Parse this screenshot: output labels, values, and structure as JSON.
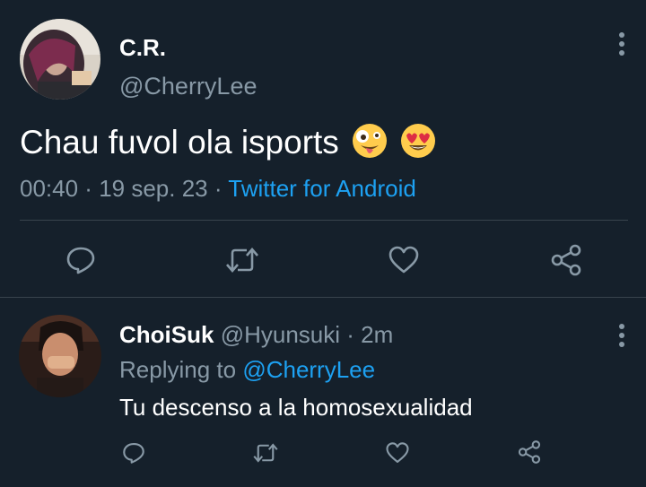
{
  "main_tweet": {
    "display_name": "C.R.",
    "handle": "@CherryLee",
    "text": "Chau fuvol ola isports",
    "emojis": [
      "zany-face-emoji",
      "heart-eyes-emoji"
    ],
    "time": "00:40",
    "separator": " · ",
    "date": "19 sep. 23",
    "source": "Twitter for Android"
  },
  "reply_tweet": {
    "display_name": "ChoiSuk",
    "handle": "@Hyunsuki",
    "age": "2m",
    "replying_label": "Replying to",
    "replying_handle": "@CherryLee",
    "text": "Tu descenso a la homosexualidad"
  },
  "icons": [
    "reply-icon",
    "retweet-icon",
    "like-icon",
    "share-icon",
    "more-options-icon"
  ],
  "colors": {
    "background": "#15202b",
    "text": "#ffffff",
    "muted": "#8899a6",
    "link": "#1da1f2",
    "divider": "#38444d"
  }
}
